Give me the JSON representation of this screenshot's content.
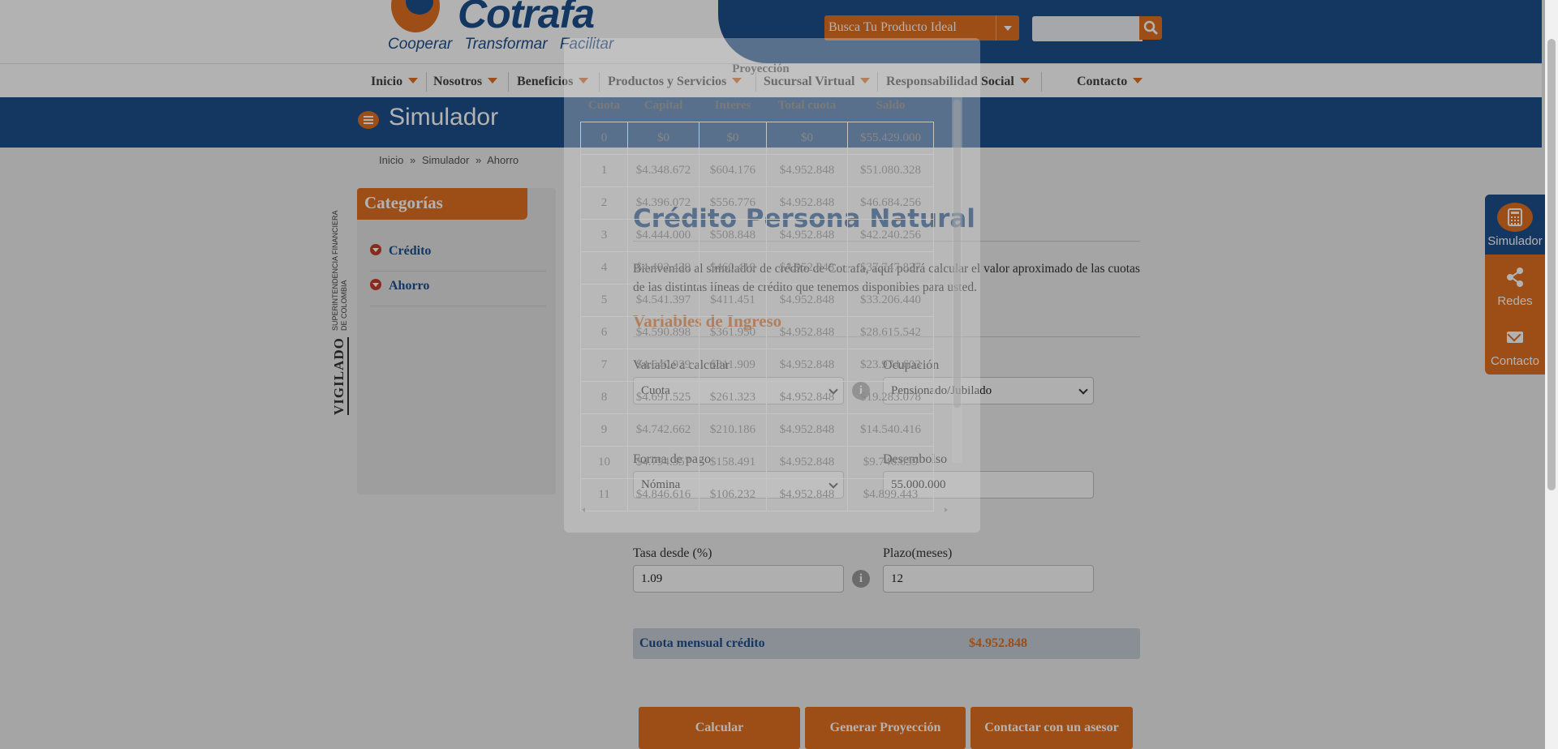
{
  "header": {
    "logo_name": "Cotrafa",
    "logo_tagline": "Cooperar   Transformar   Facilitar",
    "search_dropdown_label": "Busca Tu Producto Ideal",
    "search_placeholder": "",
    "colors": {
      "brand_blue": "#1c4f8b",
      "brand_orange": "#e07020"
    }
  },
  "nav": {
    "items": [
      {
        "label": "Inicio"
      },
      {
        "label": "Nosotros"
      },
      {
        "label": "Beneficios"
      },
      {
        "label": "Productos y Servicios"
      },
      {
        "label": "Sucursal Virtual"
      },
      {
        "label": "Responsabilidad Social"
      },
      {
        "label": "Contacto"
      }
    ]
  },
  "band": {
    "title": "Simulador"
  },
  "breadcrumb": {
    "items": [
      "Inicio",
      "»",
      "Simulador",
      "»",
      "Ahorro"
    ]
  },
  "vigilado": {
    "big": "VIGILADO",
    "line1": "SUPERINTENDENCIA FINANCIERA",
    "line2": "DE COLOMBIA"
  },
  "sidebar": {
    "title": "Categorías",
    "items": [
      {
        "label": "Crédito"
      },
      {
        "label": "Ahorro"
      }
    ]
  },
  "main": {
    "title": "Crédito Persona Natural",
    "intro": "Bienvenido al simulador de crédito de Cotrafa, aquí podrá calcular el valor aproximado de las cuotas de las distintas líneas de crédito que tenemos disponibles para usted.",
    "section_title": "Variables de Ingreso",
    "fields": {
      "variable": {
        "label": "Variable a calcular",
        "value": "Cuota"
      },
      "ocupacion": {
        "label": "Ocupación",
        "value": "Pensionado/Jubilado"
      },
      "forma_pago": {
        "label": "Forma de pago",
        "value": "Nómina"
      },
      "desembolso": {
        "label": "Desembolso",
        "value": "55.000.000"
      },
      "tasa": {
        "label": "Tasa desde (%)",
        "value": "1.09"
      },
      "plazo": {
        "label": "Plazo(meses)",
        "value": "12"
      }
    },
    "info_glyph": "i",
    "result": {
      "label": "Cuota mensual crédito",
      "value": "$4.952.848"
    },
    "buttons": {
      "calcular": "Calcular",
      "proyeccion": "Generar Proyección",
      "asesor": "Contactar con un asesor"
    }
  },
  "right_tabs": {
    "simulador": "Simulador",
    "redes": "Redes",
    "contacto": "Contacto"
  },
  "modal": {
    "title": "Proyección",
    "headers": [
      "Cuota",
      "Capital",
      "Interes",
      "Total cuota",
      "Saldo"
    ],
    "rows": [
      [
        "0",
        "$0",
        "$0",
        "$0",
        "$55.429.000"
      ],
      [
        "1",
        "$4.348.672",
        "$604.176",
        "$4.952.848",
        "$51.080.328"
      ],
      [
        "2",
        "$4.396.072",
        "$556.776",
        "$4.952.848",
        "$46.684.256"
      ],
      [
        "3",
        "$4.444.000",
        "$508.848",
        "$4.952.848",
        "$42.240.256"
      ],
      [
        "4",
        "$4.492.429",
        "$460.419",
        "$4.952.848",
        "$37.747.827"
      ],
      [
        "5",
        "$4.541.397",
        "$411.451",
        "$4.952.848",
        "$33.206.440"
      ],
      [
        "6",
        "$4.590.898",
        "$361.950",
        "$4.952.848",
        "$28.615.542"
      ],
      [
        "7",
        "$4.640.939",
        "$311.909",
        "$4.952.848",
        "$23.974.603"
      ],
      [
        "8",
        "$4.691.525",
        "$261.323",
        "$4.952.848",
        "$19.283.078"
      ],
      [
        "9",
        "$4.742.662",
        "$210.186",
        "$4.952.848",
        "$14.540.416"
      ],
      [
        "10",
        "$4.794.357",
        "$158.491",
        "$4.952.848",
        "$9.746.059"
      ],
      [
        "11",
        "$4.846.616",
        "$106.232",
        "$4.952.848",
        "$4.899.443"
      ]
    ]
  }
}
